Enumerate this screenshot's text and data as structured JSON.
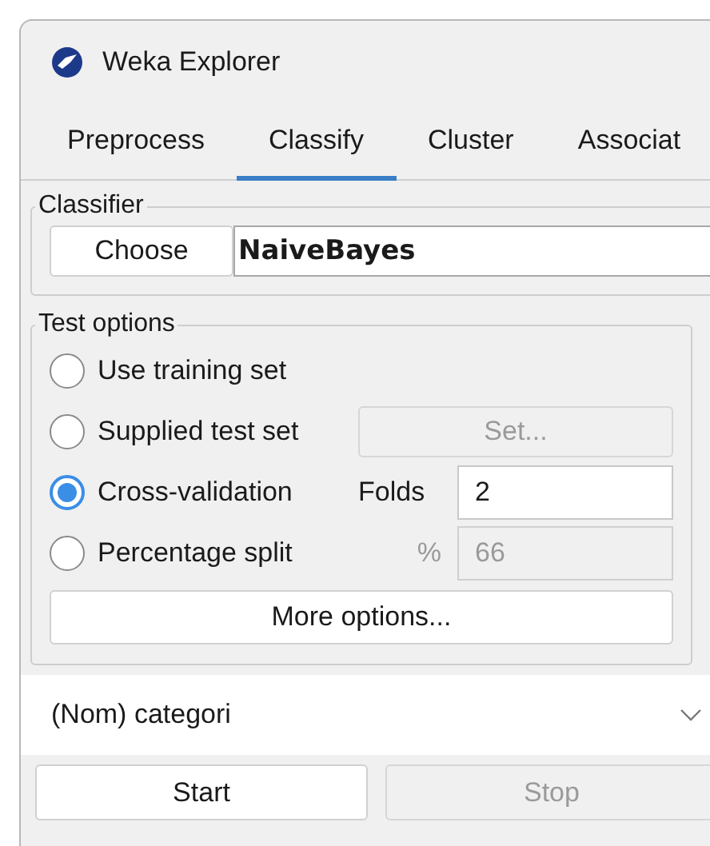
{
  "window": {
    "title": "Weka Explorer"
  },
  "tabs": [
    {
      "label": "Preprocess",
      "selected": false
    },
    {
      "label": "Classify",
      "selected": true
    },
    {
      "label": "Cluster",
      "selected": false
    },
    {
      "label": "Associat",
      "selected": false
    }
  ],
  "classifier": {
    "group_label": "Classifier",
    "choose_button": "Choose",
    "name": "NaiveBayes"
  },
  "test_options": {
    "group_label": "Test options",
    "options": [
      {
        "label": "Use training set",
        "selected": false
      },
      {
        "label": "Supplied test set",
        "selected": false,
        "control": {
          "kind": "button",
          "label": "Set...",
          "disabled": true
        }
      },
      {
        "label": "Cross-validation",
        "selected": true,
        "control": {
          "kind": "field",
          "label": "Folds",
          "value": "2",
          "disabled": false
        }
      },
      {
        "label": "Percentage split",
        "selected": false,
        "control": {
          "kind": "field",
          "label": "%",
          "value": "66",
          "disabled": true
        }
      }
    ],
    "more_button": "More options..."
  },
  "class_dropdown": {
    "value": "(Nom) categori"
  },
  "buttons": [
    {
      "label": "Start",
      "disabled": false
    },
    {
      "label": "Stop",
      "disabled": true
    }
  ]
}
